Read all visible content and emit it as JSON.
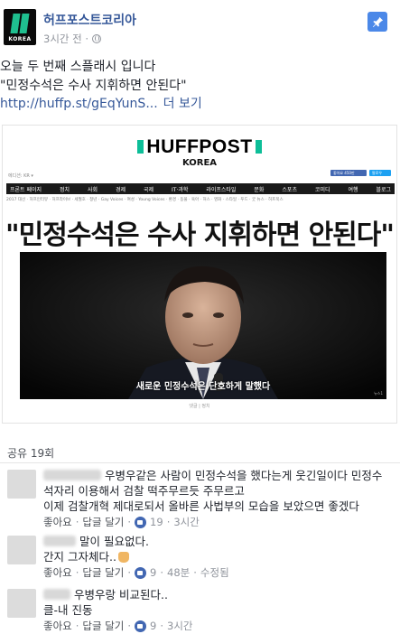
{
  "header": {
    "page_name": "허프포스트코리아",
    "logo_text": "KOREA",
    "time": "3시간 전 ·"
  },
  "post": {
    "line1": "오늘 두 번째 스플래시 입니다",
    "line2": "\"민정수석은 수사 지휘하면 안된다\"",
    "link": "http://huffp.st/gEqYunS...",
    "see_more": "더 보기"
  },
  "preview": {
    "logo": "HUFFPOST",
    "edition_label": "KOREA",
    "edition_line": "에디션: KR ▾",
    "like_button": "좋아요 450만",
    "follow_button": "팔로우",
    "nav_items": [
      "프론트 페이지",
      "정치",
      "사회",
      "경제",
      "국제",
      "IT·과학",
      "라이프스타일",
      "문화",
      "스포츠",
      "코미디",
      "여행",
      "블로그"
    ],
    "subnav": "2017 대선 · 허프인터뷰 · 허프라이브 · 세월호 · 청년 · Gay Voices · 여성 · Young Voices · 환경 · 동물 · 육아 · 허스 · 영화 · 스타일 · 푸드 · 굿 뉴스 · 허프북스",
    "headline": "\"민정수석은 수사 지휘하면 안된다\"",
    "photo_caption": "새로운 민정수석은 단호하게 말했다",
    "photo_credit": "뉴스1",
    "footer": "댓글 | 정치"
  },
  "shares": "공유 19회",
  "comments": [
    {
      "lines": [
        "우병우같은 사람이 민정수석을 했다는게 웃긴일이다 민정수",
        "석자리 이용해서 검찰 떡주무르듯 주무르고",
        "이제 검찰개혁 제대로되서 올바른 사법부의 모습을 보았으면 좋겠다"
      ],
      "like": "좋아요",
      "reply": "답글 달기",
      "likes": "19",
      "time": "3시간",
      "edited": ""
    },
    {
      "lines": [
        "말이 필요없다.",
        "간지 그자체다.."
      ],
      "like": "좋아요",
      "reply": "답글 달기",
      "likes": "9",
      "time": "48분",
      "edited": "수정됨"
    },
    {
      "lines": [
        "우병우랑 비교된다..",
        "클-내 진동"
      ],
      "like": "좋아요",
      "reply": "답글 달기",
      "likes": "9",
      "time": "3시간",
      "edited": ""
    }
  ]
}
